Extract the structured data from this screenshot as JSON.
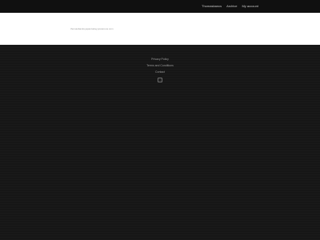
{
  "nav": {
    "items": [
      {
        "label": "Thomasbancs"
      },
      {
        "label": "Archive"
      },
      {
        "label": "My account"
      }
    ]
  },
  "hero": {
    "tagline": "thomasbanks.japantoday.posterous.com"
  },
  "footer": {
    "links": [
      {
        "label": "Privacy Policy"
      },
      {
        "label": "Terms and Conditions"
      },
      {
        "label": "Contact"
      }
    ],
    "social_icon": "twitter-icon",
    "social_glyph": "t"
  }
}
